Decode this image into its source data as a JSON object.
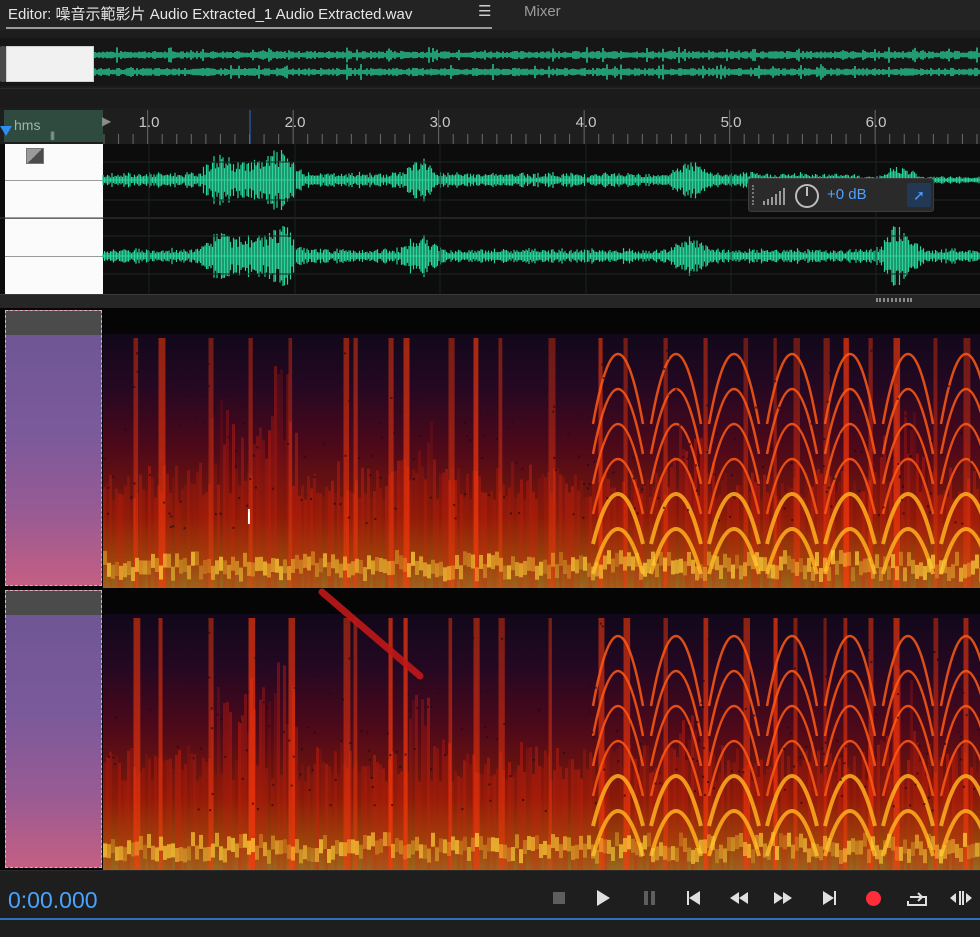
{
  "tabs": {
    "editor_label": "Editor: 噪音示範影片 Audio Extracted_1 Audio Extracted.wav",
    "menu_icon": "hamburger-icon",
    "mixer_label": "Mixer"
  },
  "ruler": {
    "unit_label": "hms",
    "ticks": [
      "1.0",
      "2.0",
      "3.0",
      "4.0",
      "5.0",
      "6.0"
    ]
  },
  "hud": {
    "gain_label": "+0 dB",
    "level_icon": "level-bars-icon",
    "knob_icon": "volume-knob-icon",
    "pin_icon": "pin-icon"
  },
  "transport": {
    "timecode": "0:00.000",
    "buttons": [
      "stop-icon",
      "play-icon",
      "pause-icon",
      "skip-to-start-icon",
      "rewind-icon",
      "fast-forward-icon",
      "skip-to-end-icon",
      "record-icon",
      "loop-icon",
      "skip-selection-icon"
    ]
  },
  "colors": {
    "waveform": "#28d49a",
    "timecode": "#4aa2ff",
    "record": "#ff2d3a",
    "selection_accent": "#2f8cf0"
  }
}
